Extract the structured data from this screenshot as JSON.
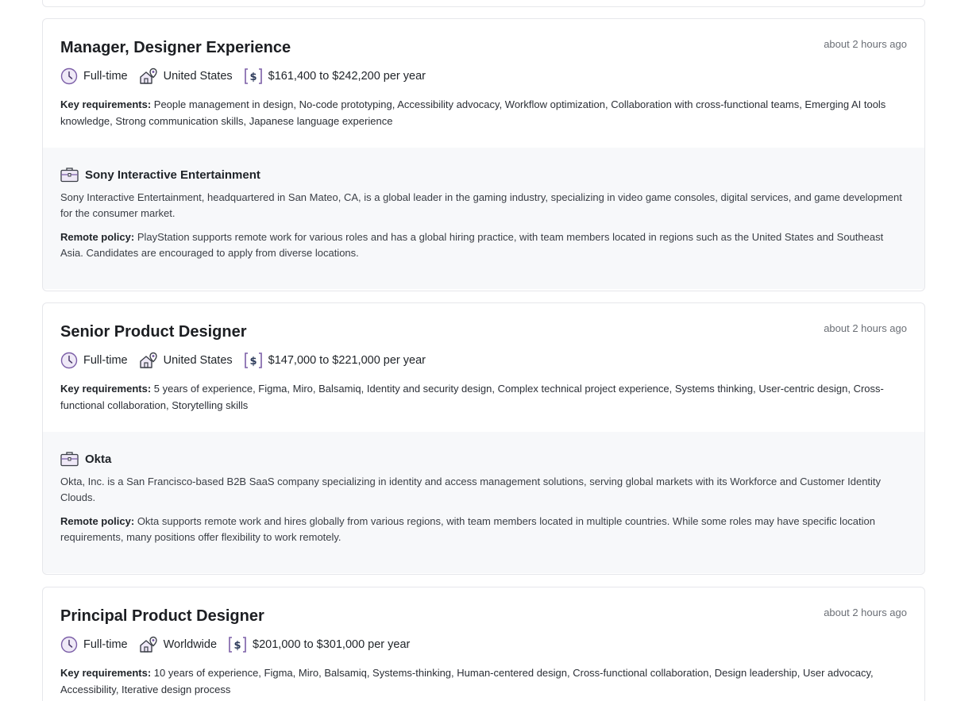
{
  "jobs": [
    {
      "title": "Manager, Designer Experience",
      "posted": "about 2 hours ago",
      "type": "Full-time",
      "location": "United States",
      "salary": "$161,400 to $242,200 per year",
      "requirements_label": "Key requirements:",
      "requirements": "People management in design, No-code prototyping, Accessibility advocacy, Workflow optimization, Collaboration with cross-functional teams, Emerging AI tools knowledge, Strong communication skills, Japanese language experience",
      "company": {
        "name": "Sony Interactive Entertainment",
        "description": "Sony Interactive Entertainment, headquartered in San Mateo, CA, is a global leader in the gaming industry, specializing in video game consoles, digital services, and game development for the consumer market.",
        "policy_label": "Remote policy:",
        "policy": "PlayStation supports remote work for various roles and has a global hiring practice, with team members located in regions such as the United States and Southeast Asia. Candidates are encouraged to apply from diverse locations."
      }
    },
    {
      "title": "Senior Product Designer",
      "posted": "about 2 hours ago",
      "type": "Full-time",
      "location": "United States",
      "salary": "$147,000 to $221,000 per year",
      "requirements_label": "Key requirements:",
      "requirements": "5 years of experience, Figma, Miro, Balsamiq, Identity and security design, Complex technical project experience, Systems thinking, User-centric design, Cross-functional collaboration, Storytelling skills",
      "company": {
        "name": "Okta",
        "description": "Okta, Inc. is a San Francisco-based B2B SaaS company specializing in identity and access management solutions, serving global markets with its Workforce and Customer Identity Clouds.",
        "policy_label": "Remote policy:",
        "policy": "Okta supports remote work and hires globally from various regions, with team members located in multiple countries. While some roles may have specific location requirements, many positions offer flexibility to work remotely."
      }
    },
    {
      "title": "Principal Product Designer",
      "posted": "about 2 hours ago",
      "type": "Full-time",
      "location": "Worldwide",
      "salary": "$201,000 to $301,000 per year",
      "requirements_label": "Key requirements:",
      "requirements": "10 years of experience, Figma, Miro, Balsamiq, Systems-thinking, Human-centered design, Cross-functional collaboration, Design leadership, User advocacy, Accessibility, Iterative design process"
    }
  ],
  "icons": {
    "type": "clock-icon",
    "location": "house-pin-icon",
    "salary": "dollar-icon",
    "company": "briefcase-icon"
  },
  "colors": {
    "icon_accent": "#7b5ea7",
    "card_border": "#e6e7eb",
    "company_bg": "#f7f8fa"
  }
}
